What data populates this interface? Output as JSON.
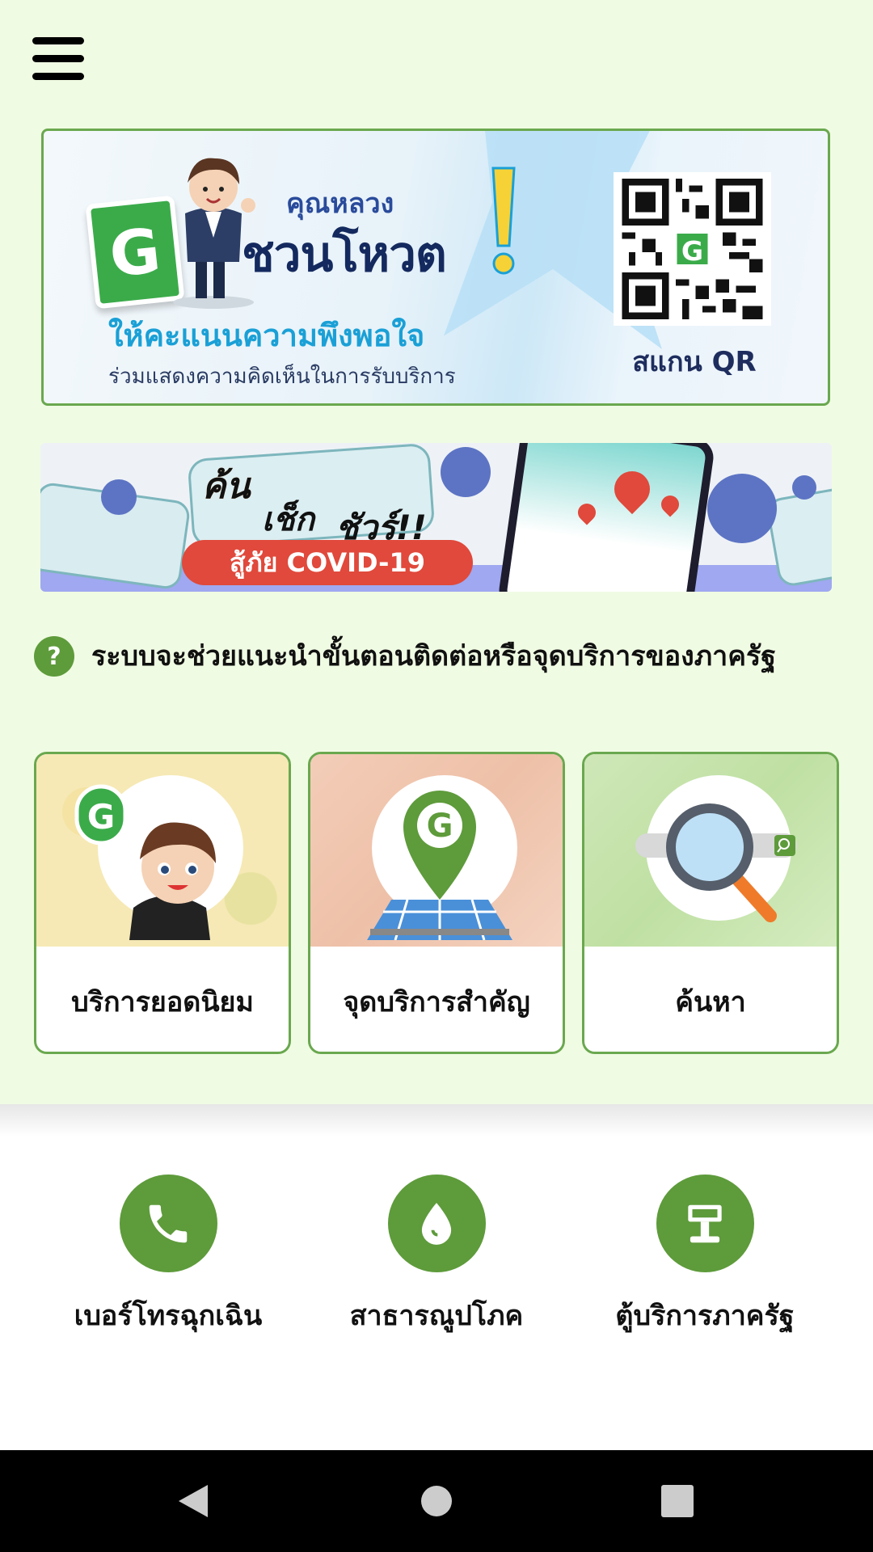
{
  "banner_vote": {
    "title_small": "คุณหลวง",
    "title_big": "ชวนโหวต",
    "subtitle": "ให้คะแนนความพึงพอใจ",
    "caption": "ร่วมแสดงความคิดเห็นในการรับบริการ",
    "scan_label": "สแกน QR",
    "logo_letter": "G"
  },
  "banner_covid": {
    "text1": "ค้น",
    "text2": "เช็ก",
    "text3": "ชัวร์!!",
    "pill": "สู้ภัย COVID-19"
  },
  "info": {
    "icon_glyph": "?",
    "text": "ระบบจะช่วยแนะนำขั้นตอนติดต่อหรือจุดบริการของภาครัฐ"
  },
  "cards": [
    {
      "label": "บริการยอดนิยม"
    },
    {
      "label": "จุดบริการสำคัญ"
    },
    {
      "label": "ค้นหา"
    }
  ],
  "quick_links": [
    {
      "label": "เบอร์โทรฉุกเฉิน",
      "icon": "phone-icon"
    },
    {
      "label": "สาธารณูปโภค",
      "icon": "water-drop-icon"
    },
    {
      "label": "ตู้บริการภาครัฐ",
      "icon": "kiosk-icon"
    }
  ],
  "colors": {
    "brand_green": "#5e9b3b",
    "card_border": "#6aa84f",
    "background": "#f0fbe3"
  }
}
